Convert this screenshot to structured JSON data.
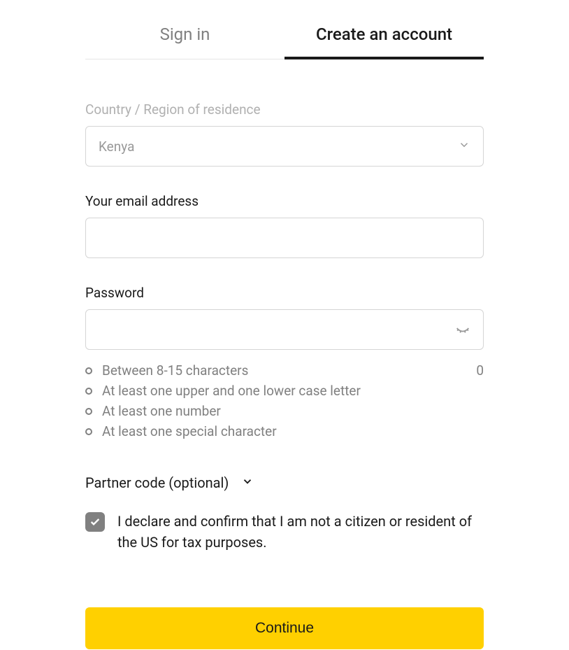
{
  "tabs": {
    "signin": "Sign in",
    "create": "Create an account"
  },
  "fields": {
    "country": {
      "label": "Country / Region of residence",
      "value": "Kenya"
    },
    "email": {
      "label": "Your email address",
      "value": ""
    },
    "password": {
      "label": "Password",
      "value": "",
      "charCount": "0",
      "rules": [
        "Between 8-15 characters",
        "At least one upper and one lower case letter",
        "At least one number",
        "At least one special character"
      ]
    }
  },
  "partner": {
    "label": "Partner code (optional)"
  },
  "declaration": {
    "text": "I declare and confirm that I am not a citizen or resident of the US for tax purposes.",
    "checked": true
  },
  "actions": {
    "continue": "Continue"
  }
}
